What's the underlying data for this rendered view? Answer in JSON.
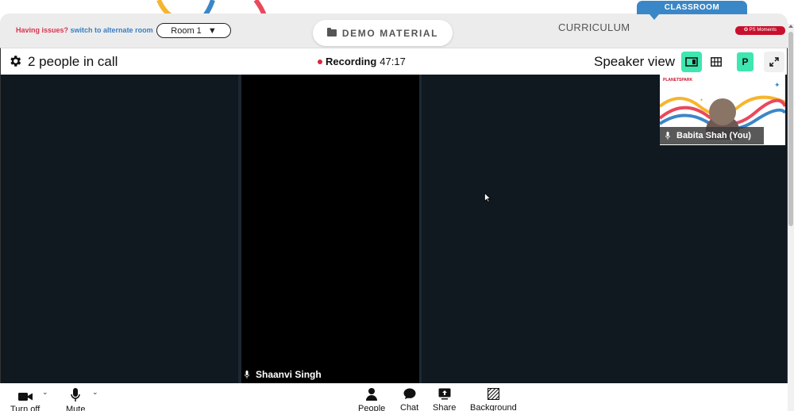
{
  "header": {
    "issues_text": "Having issues?",
    "alternate_link": "switch to alternate room",
    "room_select_value": "Room 1",
    "demo_material_label": "DEMO MATERIAL",
    "curriculum_label": "CURRICULUM",
    "classroom_tab_label": "CLASSROOM",
    "moments_label": "PS Moments"
  },
  "call": {
    "people_count_label": "2 people in call",
    "recording_label": "Recording",
    "recording_time": "47:17",
    "view_label": "Speaker view",
    "participant_initial": "P"
  },
  "participants": {
    "remote_name": "Shaanvi Singh",
    "self_name": "Babita Shah (You)",
    "self_logo_text": "PLANETSPARK"
  },
  "toolbar": {
    "camera_label": "Turn off",
    "mic_label": "Mute",
    "people_label": "People",
    "chat_label": "Chat",
    "share_label": "Share",
    "background_label": "Background"
  },
  "colors": {
    "accent_green": "#3ee6b0",
    "recording_red": "#d42a3c",
    "classroom_blue": "#3a87c7",
    "stage_bg": "#101820"
  }
}
